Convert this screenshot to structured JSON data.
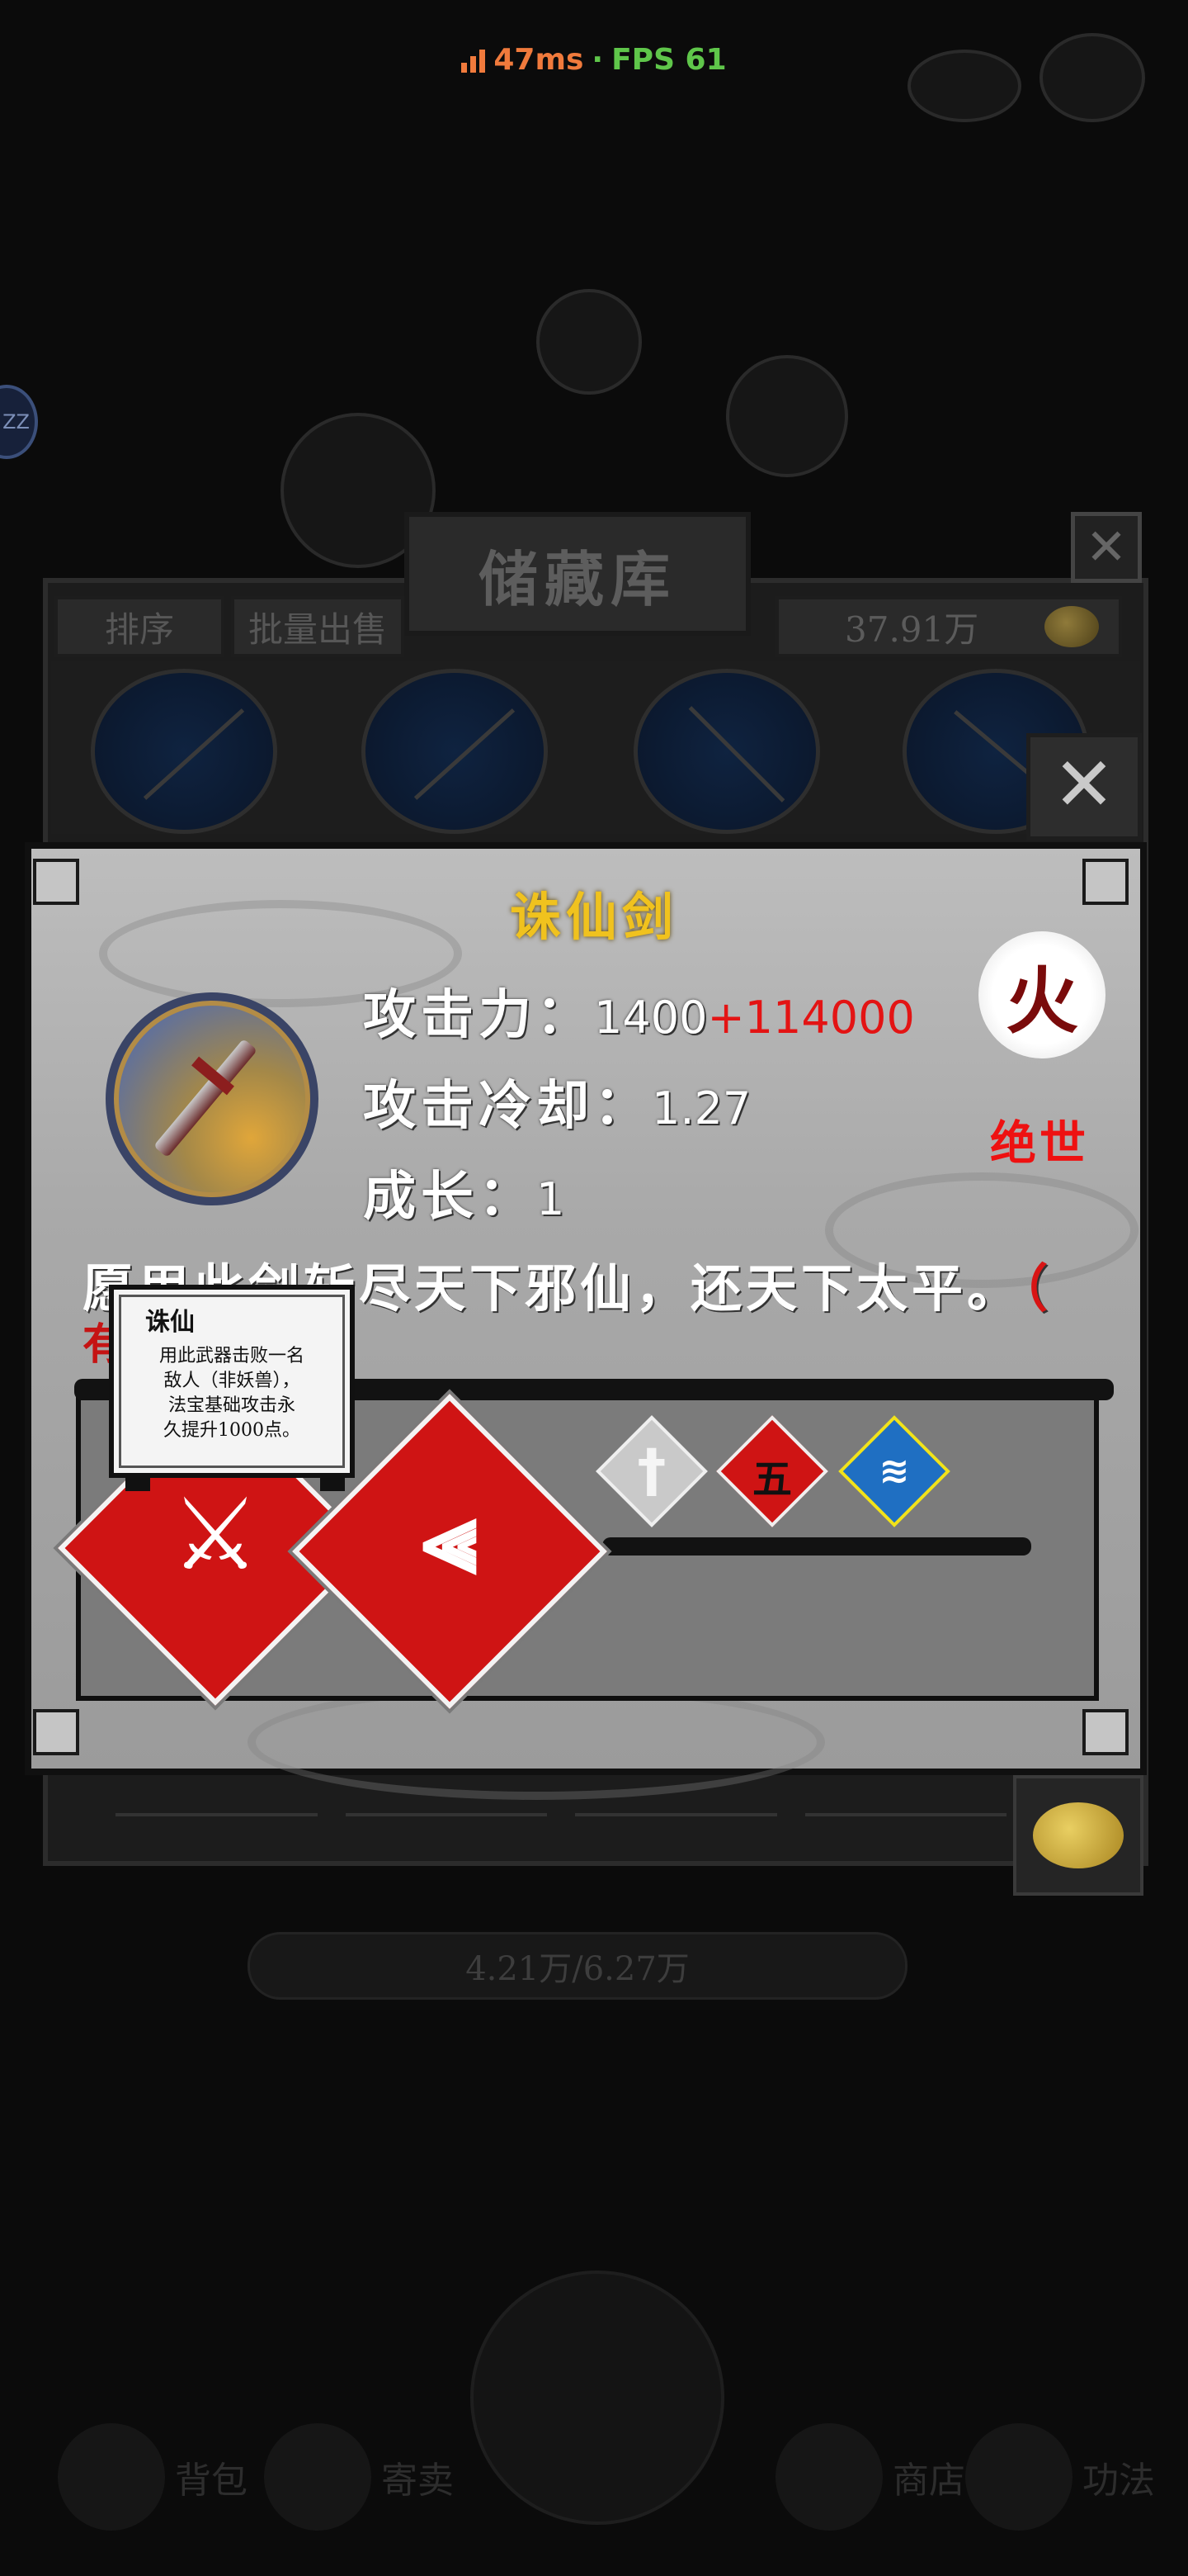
{
  "hud": {
    "ping": "47ms",
    "separator": "·",
    "fps": "FPS 61"
  },
  "status_badge": "ZZ",
  "storage": {
    "title": "储藏库",
    "tab_sort": "排序",
    "tab_batch_sell": "批量出售",
    "gold_amount": "37.91万",
    "close_label": "✕",
    "balance": "4.21万/6.27万"
  },
  "item": {
    "name": "诛仙剑",
    "element": "火",
    "rarity": "绝世",
    "stats": {
      "attack_label": "攻击力：",
      "attack_base": "1400",
      "attack_bonus": "+114000",
      "cooldown_label": "攻击冷却：",
      "cooldown_value": "1.27",
      "growth_label": "成长：",
      "growth_value": "1"
    },
    "description": "愿用此剑斩尽天下邪仙，还天下太平。",
    "description_suffix": "（",
    "description_next_line_fragment": "有"
  },
  "tooltip": {
    "title": "诛仙",
    "line1": "用此武器击败一名",
    "line2": "敌人（非妖兽），",
    "line3": "法宝基础攻击永",
    "line4": "久提升1000点。"
  },
  "skills": {
    "small_2_glyph": "五"
  },
  "bottom_nav": {
    "left_1": "背包",
    "left_2": "寄卖",
    "right_1": "商店",
    "right_2": "功法"
  },
  "colors": {
    "name_gold": "#f0c21e",
    "rarity_red": "#ee1111",
    "skill_red": "#cf1414",
    "skill_blue": "#1f6fc2",
    "skill_yellow": "#f2e21a"
  }
}
